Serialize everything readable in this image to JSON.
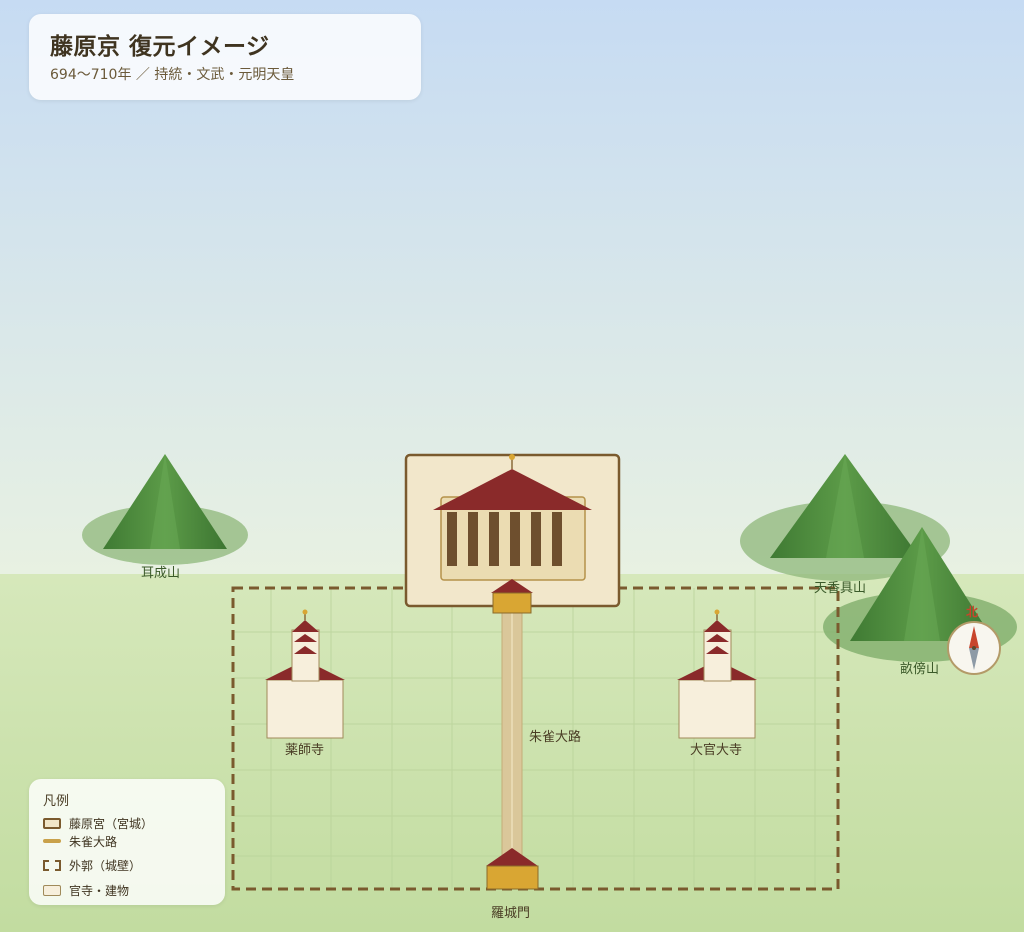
{
  "header": {
    "title": "藤原京 復元イメージ",
    "subtitle": "694〜710年 ／ 持統・文武・元明天皇"
  },
  "mountains": {
    "miminashi": "耳成山",
    "kagu": "天香具山",
    "unebi": "畝傍山"
  },
  "buildings": {
    "yakushiji": "薬師寺",
    "daikandaiji": "大官大寺",
    "rajomon": "羅城門"
  },
  "road": {
    "label": "朱雀大路"
  },
  "compass": {
    "north_label": "北"
  },
  "legend": {
    "title": "凡例",
    "items": [
      {
        "label": "藤原宮（宮城）",
        "icon": "palace-swatch"
      },
      {
        "label": "朱雀大路",
        "icon": "road-swatch"
      },
      {
        "label": "外郭（城壁）",
        "icon": "wall-swatch"
      },
      {
        "label": "官寺・建物",
        "icon": "building-swatch"
      }
    ]
  },
  "colors": {
    "sky_top": "#c6dcf2",
    "sky_bottom": "#e6f0e3",
    "ground": "#cfe3b0",
    "mountain": "#4f8a3e",
    "roof": "#8a2a2a",
    "gold": "#d9a633",
    "wall": "#7a5a2e"
  }
}
